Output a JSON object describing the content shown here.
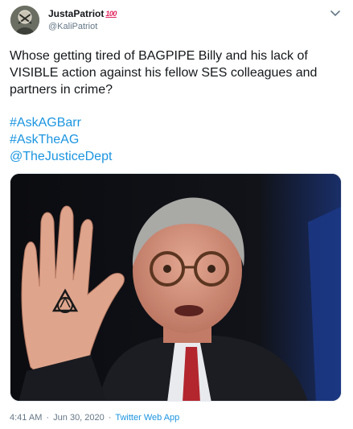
{
  "author": {
    "display_name": "JustaPatriot",
    "badge_emoji": "100",
    "handle": "@KaliPatriot"
  },
  "tweet": {
    "text": "Whose getting tired of BAGPIPE Billy and his lack of VISIBLE action against his fellow SES colleagues and partners in crime?",
    "links": [
      "#AskAGBarr",
      "#AskTheAG",
      "@TheJusticeDept"
    ]
  },
  "meta": {
    "time": "4:41 AM",
    "separator": "·",
    "date": "Jun 30, 2020",
    "source": "Twitter Web App"
  },
  "icons": {
    "more": "chevron-down-icon",
    "badge": "hundred-points-icon"
  },
  "colors": {
    "link": "#1b95e0",
    "muted": "#657786",
    "text": "#14171a"
  }
}
